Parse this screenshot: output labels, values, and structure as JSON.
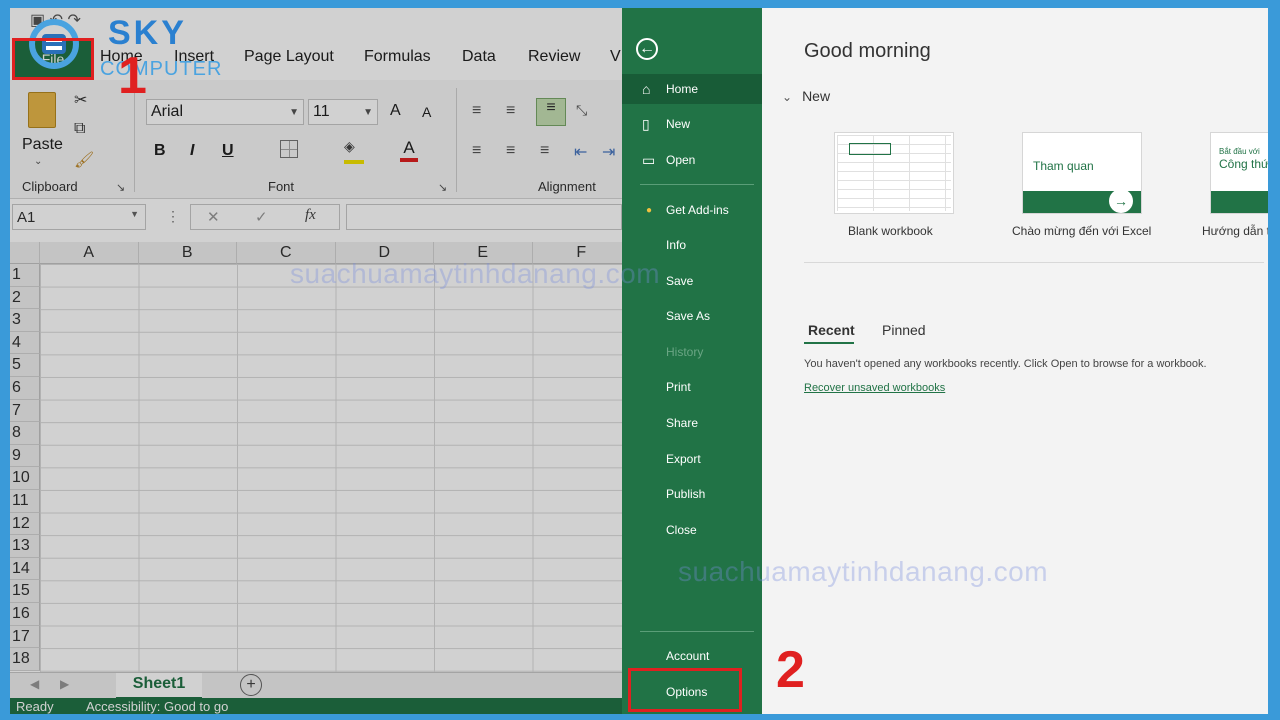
{
  "qat": {
    "undo": "↶",
    "redo": "↷"
  },
  "ribbon_tabs": {
    "file": "File",
    "home": "Home",
    "insert": "Insert",
    "page_layout": "Page Layout",
    "formulas": "Formulas",
    "data": "Data",
    "review": "Review",
    "view": "V"
  },
  "clipboard": {
    "paste": "Paste",
    "label": "Clipboard"
  },
  "font": {
    "name": "Arial",
    "size": "11",
    "label": "Font",
    "bold": "B",
    "italic": "I",
    "underline": "U",
    "grow": "A",
    "shrink": "A",
    "color": "A"
  },
  "alignment": {
    "label": "Alignment"
  },
  "formula_bar": {
    "namebox": "A1",
    "fx": "fx",
    "cancel": "✕",
    "enter": "✓"
  },
  "grid": {
    "columns": [
      "A",
      "B",
      "C",
      "D",
      "E",
      "F"
    ],
    "rows": [
      "1",
      "2",
      "3",
      "4",
      "5",
      "6",
      "7",
      "8",
      "9",
      "10",
      "11",
      "12",
      "13",
      "14",
      "15",
      "16",
      "17",
      "18"
    ]
  },
  "sheet": {
    "tab": "Sheet1",
    "add": "+"
  },
  "status": {
    "ready": "Ready",
    "accessibility": "Accessibility: Good to go"
  },
  "backstage": {
    "nav": {
      "home": "Home",
      "new": "New",
      "open": "Open",
      "get_addins": "Get Add-ins",
      "info": "Info",
      "save": "Save",
      "save_as": "Save As",
      "history": "History",
      "print": "Print",
      "share": "Share",
      "export": "Export",
      "publish": "Publish",
      "close": "Close",
      "account": "Account",
      "options": "Options"
    },
    "greeting": "Good morning",
    "new_section": "New",
    "templates": [
      {
        "label": "Blank workbook"
      },
      {
        "label": "Chào mừng đến với Excel",
        "thumb_text": "Tham quan"
      },
      {
        "label": "Hướng dẫn t",
        "thumb_text_small": "Bắt đầu với",
        "thumb_text": "Công thứ"
      }
    ],
    "recent_tab": "Recent",
    "pinned_tab": "Pinned",
    "empty_text": "You haven't opened any workbooks recently. Click Open to browse for a workbook.",
    "recover_link": "Recover unsaved workbooks"
  },
  "annotations": {
    "step1": "1",
    "step2": "2"
  },
  "logo": {
    "line1": "SKY",
    "line2": "COMPUTER"
  },
  "watermark": "suachuamaytinhdanang.com",
  "colors": {
    "excel_green": "#217346",
    "annotation_red": "#e02020",
    "frame_blue": "#3a9ad9"
  }
}
